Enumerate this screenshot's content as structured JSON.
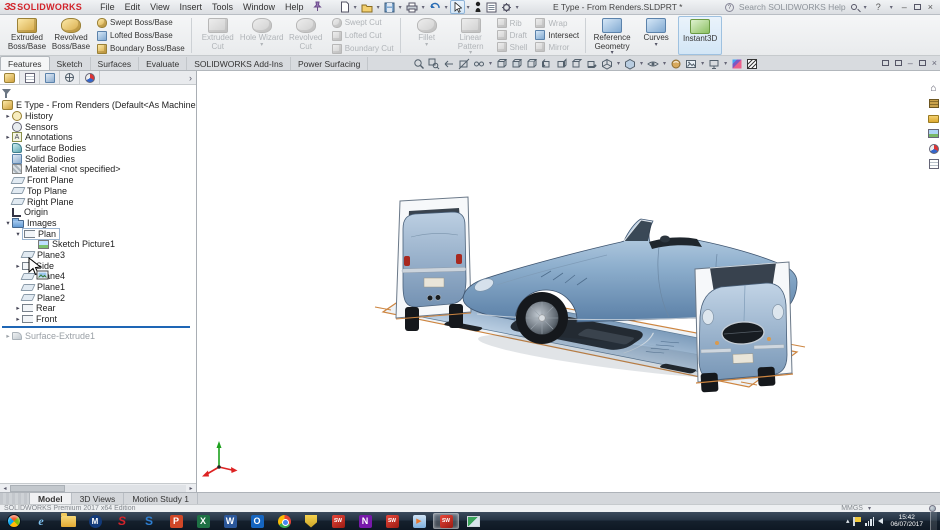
{
  "titlebar": {
    "logo_mark": "ЗS",
    "logo_text": "SOLIDWORKS",
    "menus": {
      "file": "File",
      "edit": "Edit",
      "view": "View",
      "insert": "Insert",
      "tools": "Tools",
      "window": "Window",
      "help": "Help"
    },
    "document_title": "E Type - From Renders.SLDPRT *",
    "search_label": "Search SOLIDWORKS Help",
    "quick_access_names": [
      "new-document",
      "open-document",
      "save",
      "print",
      "undo",
      "select",
      "xpress-products",
      "options-list",
      "settings"
    ]
  },
  "ribbon": {
    "boss_group": {
      "extruded_boss": "Extruded Boss/Base",
      "revolved_boss": "Revolved Boss/Base",
      "swept_boss": "Swept Boss/Base",
      "lofted_boss": "Lofted Boss/Base",
      "boundary_boss": "Boundary Boss/Base"
    },
    "cut_group": {
      "extruded_cut": "Extruded Cut",
      "hole_wizard": "Hole Wizard",
      "revolved_cut": "Revolved Cut",
      "swept_cut": "Swept Cut",
      "lofted_cut": "Lofted Cut",
      "boundary_cut": "Boundary Cut"
    },
    "feature_group": {
      "fillet": "Fillet",
      "linear_pattern": "Linear Pattern",
      "rib": "Rib",
      "draft": "Draft",
      "shell": "Shell",
      "wrap": "Wrap",
      "intersect": "Intersect",
      "mirror": "Mirror"
    },
    "reference_group": {
      "reference_geometry": "Reference Geometry",
      "curves": "Curves",
      "instant3d": "Instant3D"
    }
  },
  "command_tabs": {
    "features": "Features",
    "sketch": "Sketch",
    "surfaces": "Surfaces",
    "evaluate": "Evaluate",
    "addins": "SOLIDWORKS Add-Ins",
    "power_surfacing": "Power Surfacing"
  },
  "heads_up_names": [
    "zoom-to-fit",
    "zoom-to-area",
    "previous-view",
    "section-view",
    "dynamic-annotation-views",
    "view-orientation",
    "front-view",
    "back-view",
    "left-view",
    "right-view",
    "top-view",
    "bottom-view",
    "isometric-view",
    "display-style",
    "hide-show-items",
    "edit-appearance",
    "apply-scene",
    "view-settings",
    "realview-graphics",
    "white-scene"
  ],
  "manager_tab_names": [
    "feature-manager",
    "property-manager",
    "configuration-manager",
    "dimxpert-manager",
    "display-manager"
  ],
  "tree": {
    "root": "E Type - From Renders (Default<As Machined> <<Default>_Display Stat",
    "icon_glyphs": {
      "annotations": "A"
    },
    "items": {
      "history": "History",
      "sensors": "Sensors",
      "annotations": "Annotations",
      "surface_bodies": "Surface Bodies",
      "solid_bodies": "Solid Bodies",
      "material": "Material <not specified>",
      "front_plane": "Front Plane",
      "top_plane": "Top Plane",
      "right_plane": "Right Plane",
      "origin": "Origin",
      "images": "Images",
      "plan": "Plan",
      "sketch_picture1": "Sketch Picture1",
      "plane3": "Plane3",
      "side": "Side",
      "plane4": "Plane4",
      "plane1": "Plane1",
      "plane2": "Plane2",
      "rear": "Rear",
      "front": "Front",
      "surface_extrude1": "Surface-Extrude1"
    }
  },
  "scene": {
    "sketch_pictures": [
      "Rear view",
      "Side view",
      "Plan view",
      "Front view"
    ]
  },
  "task_pane_names": [
    "solidworks-resources",
    "design-library",
    "file-explorer",
    "view-palette",
    "appearances-scenes",
    "custom-properties"
  ],
  "bottom_tabs": {
    "model": "Model",
    "views3d": "3D Views",
    "motion": "Motion Study 1"
  },
  "statusbar": {
    "edition": "SOLIDWORKS Premium 2017 x64 Edition",
    "units": "MMGS"
  },
  "taskbar": {
    "apps": {
      "ie": {
        "glyph": "e"
      },
      "m_app": {
        "glyph": "M"
      },
      "red_s": {
        "glyph": "S"
      },
      "blue_s": {
        "glyph": "S"
      },
      "powerpoint": {
        "glyph": "P"
      },
      "excel": {
        "glyph": "X"
      },
      "word": {
        "glyph": "W"
      },
      "outlook": {
        "glyph": "O"
      },
      "sw2016": {
        "glyph": "SW"
      },
      "onenote": {
        "glyph": "N"
      },
      "sw2017": {
        "glyph": "SW"
      },
      "sw_active": {
        "glyph": "SW"
      }
    },
    "tray_names": [
      "show-hidden-icons",
      "action-center-flag",
      "network",
      "volume"
    ],
    "clock_time": "15:42",
    "clock_date": "06/07/2017"
  },
  "icons": {
    "caret_down": "▾",
    "expand_collapsed": "▸",
    "expand_expanded": "▾",
    "flyout_right": "›",
    "scroll_left": "◂",
    "scroll_right": "▸",
    "tray_up": "▴",
    "minimize": "–",
    "close": "×",
    "help": "?",
    "play": "▶"
  },
  "colors": {
    "selection_orange": "#cd8540",
    "rollback_blue": "#1e66b5",
    "sw_red": "#d2232a",
    "car_body_blue": "#8fb0ce"
  }
}
